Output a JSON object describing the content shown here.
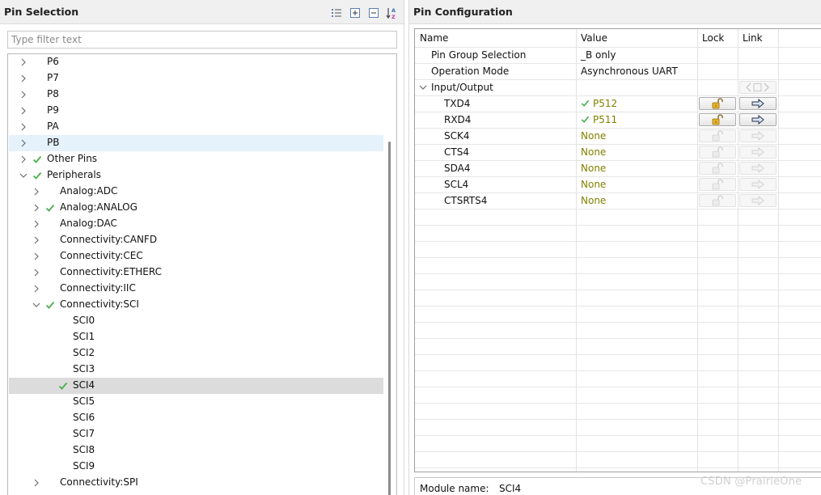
{
  "left_panel": {
    "title": "Pin Selection",
    "toolbar": [
      "list-view-icon",
      "expand-all-icon",
      "collapse-all-icon",
      "sort-az-icon"
    ],
    "filter_placeholder": "Type filter text",
    "tree": [
      {
        "label": "P6",
        "twisty": "collapsed",
        "check": false
      },
      {
        "label": "P7",
        "twisty": "collapsed",
        "check": false
      },
      {
        "label": "P8",
        "twisty": "collapsed",
        "check": false
      },
      {
        "label": "P9",
        "twisty": "collapsed",
        "check": false
      },
      {
        "label": "PA",
        "twisty": "collapsed",
        "check": false
      },
      {
        "label": "PB",
        "twisty": "collapsed",
        "check": false,
        "state": "hover"
      },
      {
        "label": "Other Pins",
        "twisty": "collapsed",
        "check": true
      },
      {
        "label": "Peripherals",
        "twisty": "expanded",
        "check": true
      },
      {
        "label": "Analog:ADC",
        "twisty": "collapsed",
        "check": false
      },
      {
        "label": "Analog:ANALOG",
        "twisty": "collapsed",
        "check": true
      },
      {
        "label": "Analog:DAC",
        "twisty": "collapsed",
        "check": false
      },
      {
        "label": "Connectivity:CANFD",
        "twisty": "collapsed",
        "check": false
      },
      {
        "label": "Connectivity:CEC",
        "twisty": "collapsed",
        "check": false
      },
      {
        "label": "Connectivity:ETHERC",
        "twisty": "collapsed",
        "check": false
      },
      {
        "label": "Connectivity:IIC",
        "twisty": "collapsed",
        "check": false
      },
      {
        "label": "Connectivity:SCI",
        "twisty": "expanded",
        "check": true
      },
      {
        "label": "SCI0",
        "twisty": "none",
        "check": false
      },
      {
        "label": "SCI1",
        "twisty": "none",
        "check": false
      },
      {
        "label": "SCI2",
        "twisty": "none",
        "check": false
      },
      {
        "label": "SCI3",
        "twisty": "none",
        "check": false
      },
      {
        "label": "SCI4",
        "twisty": "none",
        "check": true,
        "state": "selected"
      },
      {
        "label": "SCI5",
        "twisty": "none",
        "check": false
      },
      {
        "label": "SCI6",
        "twisty": "none",
        "check": false
      },
      {
        "label": "SCI7",
        "twisty": "none",
        "check": false
      },
      {
        "label": "SCI8",
        "twisty": "none",
        "check": false
      },
      {
        "label": "SCI9",
        "twisty": "none",
        "check": false
      },
      {
        "label": "Connectivity:SPI",
        "twisty": "collapsed",
        "check": false
      }
    ]
  },
  "right_panel": {
    "title": "Pin Configuration",
    "columns": [
      "Name",
      "Value",
      "Lock",
      "Link"
    ],
    "rows": [
      {
        "name": "Pin Group Selection",
        "value": "_B only",
        "value_style": "plain",
        "level": "top",
        "lock": "none",
        "link": "none"
      },
      {
        "name": "Operation Mode",
        "value": "Asynchronous UART",
        "value_style": "plain",
        "level": "top",
        "lock": "none",
        "link": "none"
      },
      {
        "name": "Input/Output",
        "value": "",
        "value_style": "plain",
        "level": "group",
        "lock": "none",
        "link": "nav"
      },
      {
        "name": "TXD4",
        "value": "P512",
        "value_style": "checked",
        "level": "child",
        "lock": "active",
        "link": "active"
      },
      {
        "name": "RXD4",
        "value": "P511",
        "value_style": "checked",
        "level": "child",
        "lock": "active",
        "link": "active"
      },
      {
        "name": "SCK4",
        "value": "None",
        "value_style": "olive",
        "level": "child",
        "lock": "disabled",
        "link": "disabled"
      },
      {
        "name": "CTS4",
        "value": "None",
        "value_style": "olive",
        "level": "child",
        "lock": "disabled",
        "link": "disabled"
      },
      {
        "name": "SDA4",
        "value": "None",
        "value_style": "olive",
        "level": "child",
        "lock": "disabled",
        "link": "disabled"
      },
      {
        "name": "SCL4",
        "value": "None",
        "value_style": "olive",
        "level": "child",
        "lock": "disabled",
        "link": "disabled"
      },
      {
        "name": "CTSRTS4",
        "value": "None",
        "value_style": "olive",
        "level": "child",
        "lock": "disabled",
        "link": "disabled"
      }
    ],
    "module_label": "Module name:",
    "module_value": "SCI4"
  },
  "watermark": "CSDN @PrairieOne",
  "colors": {
    "check_green": "#4caf50",
    "value_olive": "#808000",
    "lock_gold": "#d9a21b",
    "hover_row": "#e5f1fb",
    "selected_row": "#dcdcdc"
  }
}
